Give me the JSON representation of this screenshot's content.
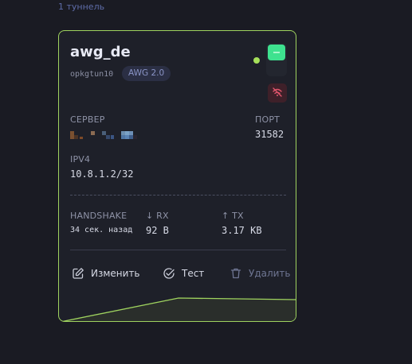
{
  "header": {
    "tunnel_count": "1 туннель"
  },
  "tunnel": {
    "name": "awg_de",
    "interface": "opkgtun10",
    "protocol_badge": "AWG 2.0",
    "status": "connected",
    "enabled": true,
    "server_label": "СЕРВЕР",
    "server_value_obscured": true,
    "port_label": "ПОРТ",
    "port": "31582",
    "ipv4_label": "IPV4",
    "ipv4": "10.8.1.2/32",
    "handshake_label": "HANDSHAKE",
    "handshake": "34 сек. назад",
    "rx_label": "↓ RX",
    "rx": "92 B",
    "tx_label": "↑ TX",
    "tx": "3.17 KB"
  },
  "actions": {
    "edit_label": "Изменить",
    "test_label": "Тест",
    "delete_label": "Удалить"
  },
  "icons": {
    "toggle": "power-toggle-icon",
    "disconnect": "disconnect-icon",
    "edit": "edit-icon",
    "test": "check-circle-icon",
    "delete": "trash-icon"
  },
  "colors": {
    "background": "#1a1b23",
    "card": "#1e2029",
    "accent_green": "#9fd35f",
    "toggle_on": "#3ee28f",
    "danger_bg": "#3e2029",
    "danger": "#e0556c",
    "badge_bg": "#2b2f44",
    "badge_text": "#8a94c6"
  }
}
